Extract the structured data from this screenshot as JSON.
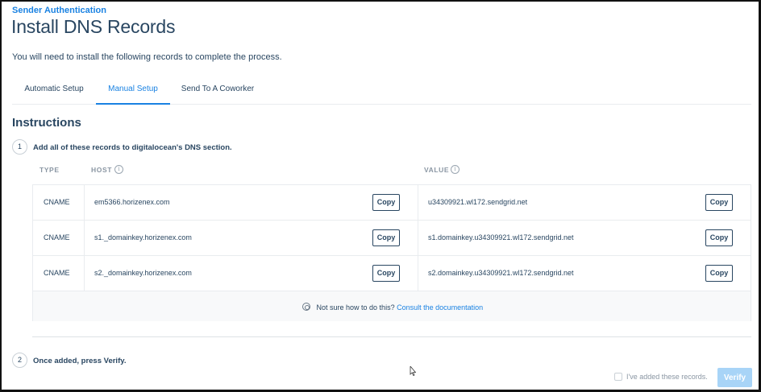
{
  "breadcrumb": "Sender Authentication",
  "title": "Install DNS Records",
  "intro": "You will need to install the following records to complete the process.",
  "tabs": [
    {
      "label": "Automatic Setup",
      "active": false
    },
    {
      "label": "Manual Setup",
      "active": true
    },
    {
      "label": "Send To A Coworker",
      "active": false
    }
  ],
  "instructions_title": "Instructions",
  "steps": [
    {
      "number": "1",
      "text": "Add all of these records to digitalocean's DNS section."
    },
    {
      "number": "2",
      "text": "Once added, press Verify."
    }
  ],
  "table": {
    "headers": {
      "type": "TYPE",
      "host": "HOST",
      "value": "VALUE"
    },
    "rows": [
      {
        "type": "CNAME",
        "host": "em5366.horizenex.com",
        "value": "u34309921.wl172.sendgrid.net"
      },
      {
        "type": "CNAME",
        "host": "s1._domainkey.horizenex.com",
        "value": "s1.domainkey.u34309921.wl172.sendgrid.net"
      },
      {
        "type": "CNAME",
        "host": "s2._domainkey.horizenex.com",
        "value": "s2.domainkey.u34309921.wl172.sendgrid.net"
      }
    ],
    "copy_label": "Copy"
  },
  "help": {
    "text": "Not sure how to do this?",
    "link": "Consult the documentation"
  },
  "confirm_checkbox_label": "I've added these records.",
  "verify_label": "Verify",
  "colors": {
    "accent": "#1a82e2",
    "heading": "#294661",
    "verify_disabled": "#a8d4f7"
  }
}
